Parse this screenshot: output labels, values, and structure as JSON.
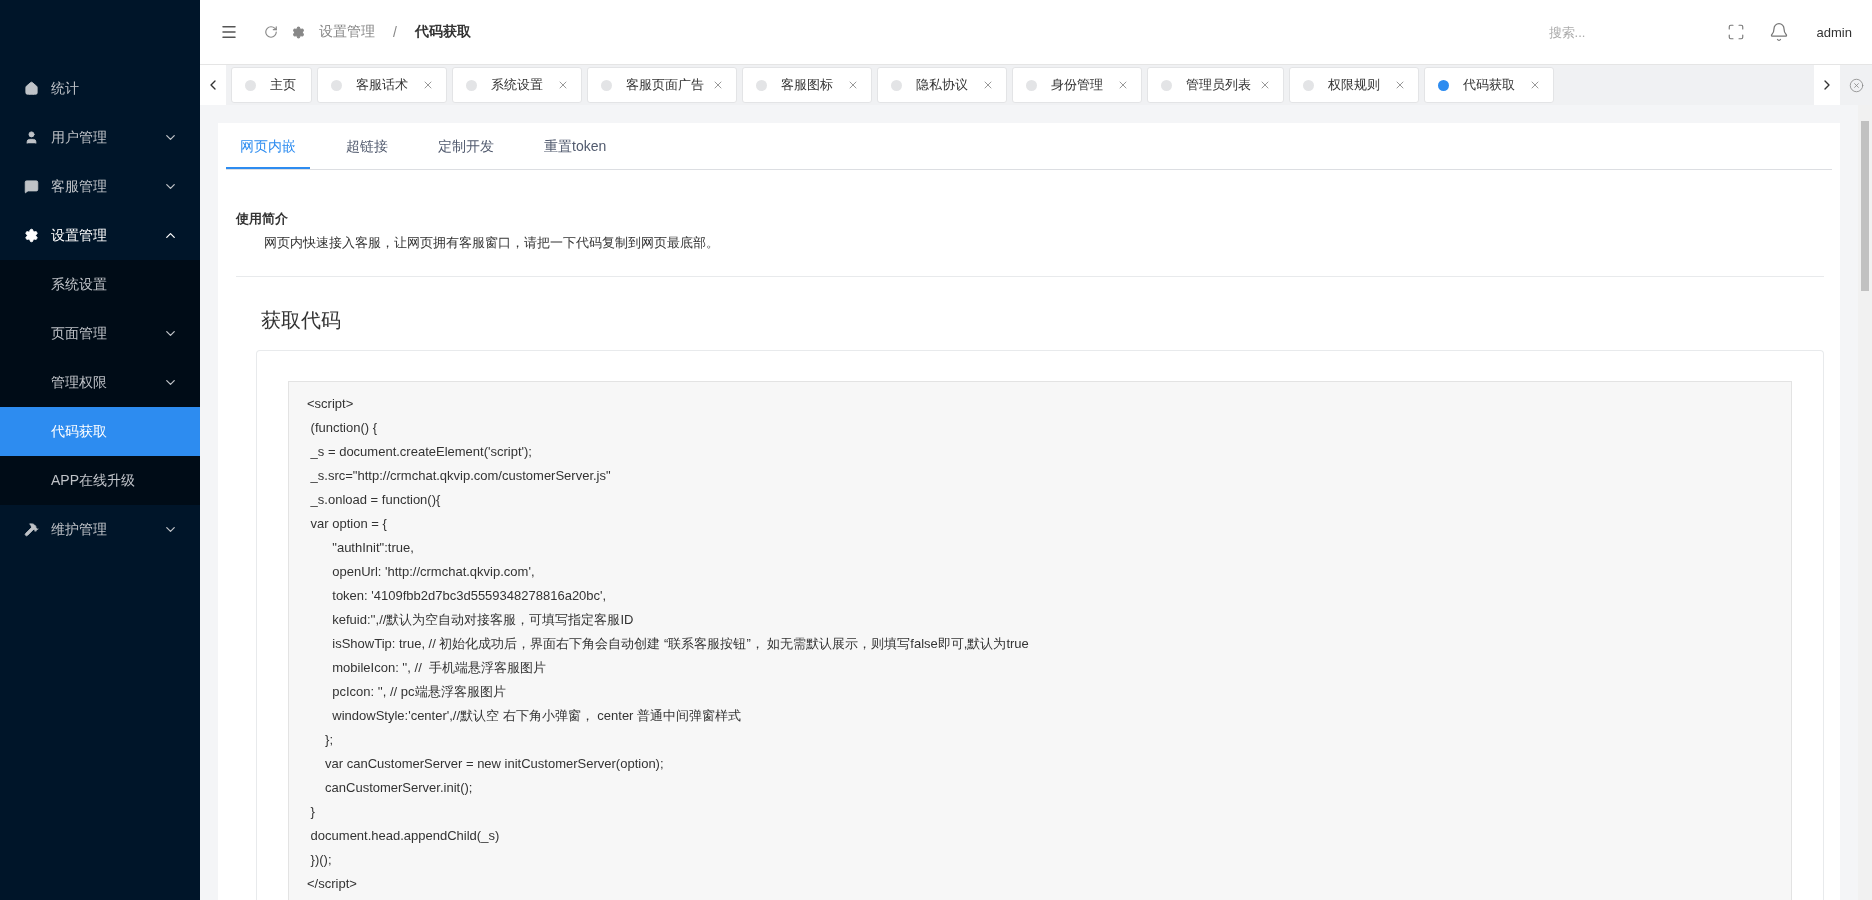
{
  "sidebar": {
    "items": [
      {
        "label": "统计",
        "has_children": false,
        "expanded": false
      },
      {
        "label": "用户管理",
        "has_children": true,
        "expanded": false
      },
      {
        "label": "客服管理",
        "has_children": true,
        "expanded": false
      },
      {
        "label": "设置管理",
        "has_children": true,
        "expanded": true,
        "children": [
          {
            "label": "系统设置",
            "has_children": false,
            "selected": false
          },
          {
            "label": "页面管理",
            "has_children": true,
            "selected": false
          },
          {
            "label": "管理权限",
            "has_children": true,
            "selected": false
          },
          {
            "label": "代码获取",
            "has_children": false,
            "selected": true
          },
          {
            "label": "APP在线升级",
            "has_children": false,
            "selected": false
          }
        ]
      },
      {
        "label": "维护管理",
        "has_children": true,
        "expanded": false
      }
    ]
  },
  "header": {
    "breadcrumb": [
      "设置管理",
      "/",
      "代码获取"
    ],
    "search": {
      "placeholder": "搜索..."
    },
    "user": "admin"
  },
  "page_tabs": [
    {
      "label": "主页",
      "selected": false,
      "closable": false
    },
    {
      "label": "客服话术",
      "selected": false,
      "closable": true
    },
    {
      "label": "系统设置",
      "selected": false,
      "closable": true
    },
    {
      "label": "客服页面广告",
      "selected": false,
      "closable": true
    },
    {
      "label": "客服图标",
      "selected": false,
      "closable": true
    },
    {
      "label": "隐私协议",
      "selected": false,
      "closable": true
    },
    {
      "label": "身份管理",
      "selected": false,
      "closable": true
    },
    {
      "label": "管理员列表",
      "selected": false,
      "closable": true
    },
    {
      "label": "权限规则",
      "selected": false,
      "closable": true
    },
    {
      "label": "代码获取",
      "selected": true,
      "closable": true
    }
  ],
  "content_tabs": [
    {
      "label": "网页内嵌",
      "selected": true
    },
    {
      "label": "超链接",
      "selected": false
    },
    {
      "label": "定制开发",
      "selected": false
    },
    {
      "label": "重置token",
      "selected": false
    }
  ],
  "intro": {
    "title": "使用简介",
    "text": "网页内快速接入客服，让网页拥有客服窗口，请把一下代码复制到网页最底部。"
  },
  "code_section": {
    "title": "获取代码",
    "lines": [
      "<script>",
      " (function() {",
      " _s = document.createElement('script');",
      " _s.src=\"http://crmchat.qkvip.com/customerServer.js\"",
      " _s.onload = function(){",
      " var option = {",
      "       \"authInit\":true,",
      "       openUrl: 'http://crmchat.qkvip.com',",
      "       token: '4109fbb2d7bc3d5559348278816a20bc',",
      "       kefuid:'',//默认为空自动对接客服，可填写指定客服ID",
      "       isShowTip: true, // 初始化成功后，界面右下角会自动创建 “联系客服按钮”， 如无需默认展示，则填写false即可,默认为true",
      "       mobileIcon: '', //  手机端悬浮客服图片",
      "       pcIcon: '', // pc端悬浮客服图片",
      "       windowStyle:'center',//默认空 右下角小弹窗， center 普通中间弹窗样式",
      "     };",
      "     var canCustomerServer = new initCustomerServer(option);",
      "     canCustomerServer.init();",
      " }",
      " document.head.appendChild(_s)",
      " })();",
      "</script>"
    ]
  }
}
